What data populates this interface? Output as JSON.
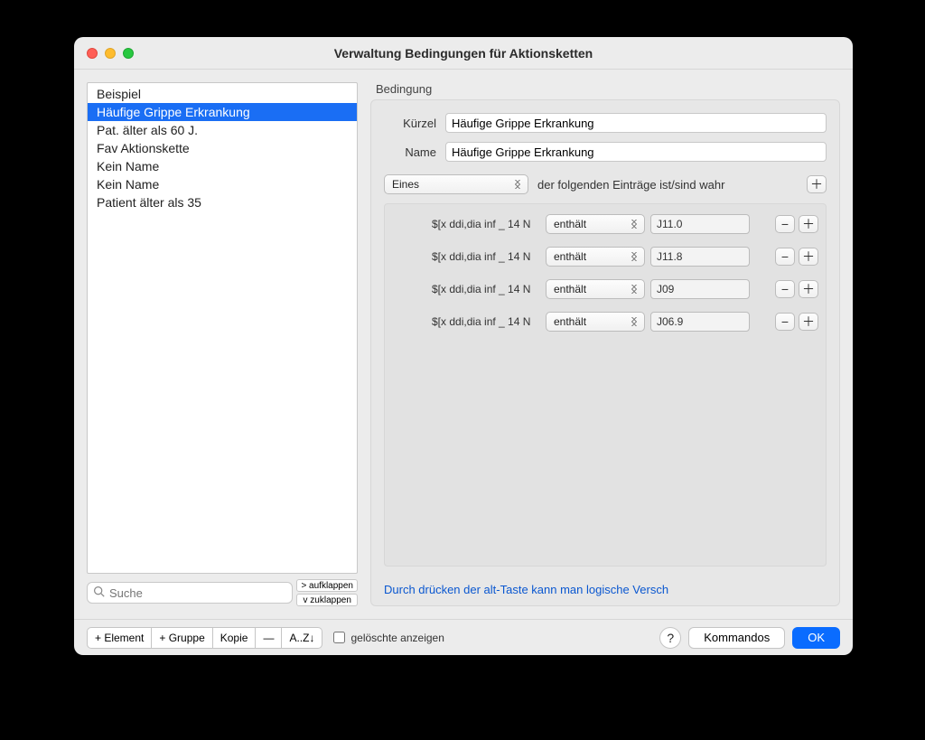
{
  "window": {
    "title": "Verwaltung Bedingungen für Aktionsketten"
  },
  "list": {
    "items": [
      "Beispiel",
      "Häufige Grippe Erkrankung",
      "Pat. älter als 60 J.",
      "Fav Aktionskette",
      "Kein Name",
      "Kein Name",
      "Patient älter als 35"
    ],
    "selected_index": 1
  },
  "search": {
    "placeholder": "Suche"
  },
  "fold_buttons": {
    "expand": "> aufklappen",
    "collapse": "v  zuklappen"
  },
  "group": {
    "label": "Bedingung",
    "kuerzel_label": "Kürzel",
    "kuerzel_value": "Häufige Grippe Erkrankung",
    "name_label": "Name",
    "name_value": "Häufige Grippe Erkrankung",
    "quantifier": "Eines",
    "quantifier_text": "der folgenden Einträge ist/sind wahr",
    "rules": [
      {
        "placeholder": "$[x ddi,dia inf _ 14 N",
        "operator": "enthält",
        "value": "J11.0"
      },
      {
        "placeholder": "$[x ddi,dia inf _ 14 N",
        "operator": "enthält",
        "value": "J11.8"
      },
      {
        "placeholder": "$[x ddi,dia inf _ 14 N",
        "operator": "enthält",
        "value": "J09"
      },
      {
        "placeholder": "$[x ddi,dia inf _ 14 N",
        "operator": "enthält",
        "value": "J06.9"
      }
    ],
    "hint": "Durch drücken der alt-Taste kann man logische Versch"
  },
  "footer": {
    "add_element": "+ Element",
    "add_group": "+ Gruppe",
    "copy": "Kopie",
    "remove": "—",
    "sort": "A..Z↓",
    "show_deleted": "gelöschte anzeigen",
    "help": "?",
    "commands": "Kommandos",
    "ok": "OK"
  }
}
